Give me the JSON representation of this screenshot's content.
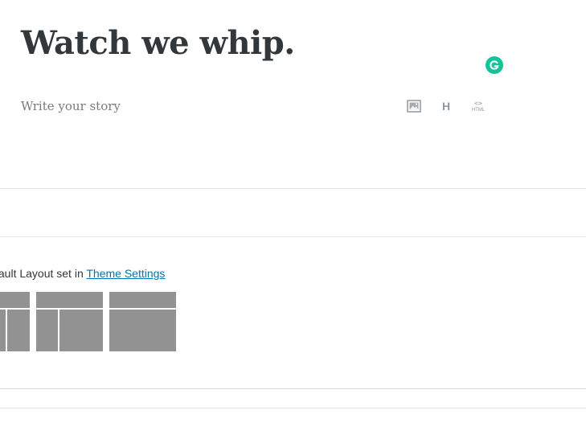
{
  "editor": {
    "title": "Watch we whip.",
    "placeholder": "Write your story",
    "tools": [
      {
        "icon": "image-icon",
        "label": ""
      },
      {
        "icon": "heading-icon",
        "label": "H"
      },
      {
        "icon": "html-icon",
        "code": "<>",
        "label": "HTML"
      }
    ],
    "grammarly_color": "#15c39a"
  },
  "layout_settings": {
    "note_prefix": "fault Layout set in ",
    "link_label": "Theme Settings",
    "options": [
      "sidebar-content-sidebar",
      "sidebar-content",
      "full-width-content"
    ]
  },
  "colors": {
    "title": "#32373c",
    "placeholder": "#757b80",
    "link": "#0073aa",
    "layout_tile": "#929292",
    "divider": "#e2e4e7"
  }
}
